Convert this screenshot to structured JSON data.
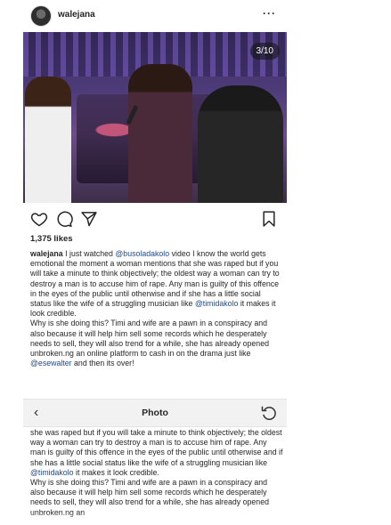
{
  "post": {
    "username": "walejana",
    "more": "···",
    "photo_counter": "3/10",
    "likes": "1,375 likes"
  },
  "caption": {
    "user": "walejana",
    "part1": " I just watched ",
    "mention1": "@busoladakolo",
    "part2": " video I know the world gets emotional the moment a woman mentions that she was raped but if you will take a minute to think objectively; the oldest way a woman can try to destroy a man is to accuse him of rape. Any man is guilty of this offence in the eyes of the public until otherwise and if she has a little social status like the wife of a struggling musician like ",
    "mention2": "@timidakolo",
    "part3": " it makes it look credible.",
    "part4": "Why is she doing this? Timi and wife are a pawn in a conspiracy and also because it will help him sell some records which he desperately needs to sell, they will also trend for a while, she has already opened unbroken.ng an online platform to cash in on the drama just like ",
    "mention3": "@esewalter",
    "part5": " and then its over!"
  },
  "viewer": {
    "back": "‹",
    "title": "Photo",
    "text1": "she was raped but if you will take a minute to think objectively; the oldest way a woman can try to destroy a man is to accuse him of rape. Any man is guilty of this offence in the eyes of the public until otherwise and if she has a little social status like the wife of a struggling musician like ",
    "mention": "@timidakolo",
    "text2": " it makes it look credible.",
    "text3": "Why is she doing this? Timi and wife are a pawn in a conspiracy and also because it will help him sell some records which he desperately needs to sell, they will also trend for a while, she has already opened unbroken.ng an"
  },
  "icons": {
    "like": "heart-outline",
    "comment": "speech-bubble-outline",
    "share": "paper-plane-outline",
    "save": "bookmark-outline",
    "refresh": "refresh-arrow"
  },
  "colors": {
    "mention": "#1f4a8a",
    "text": "#262626",
    "viewer_bar": "#f2f2f2"
  }
}
